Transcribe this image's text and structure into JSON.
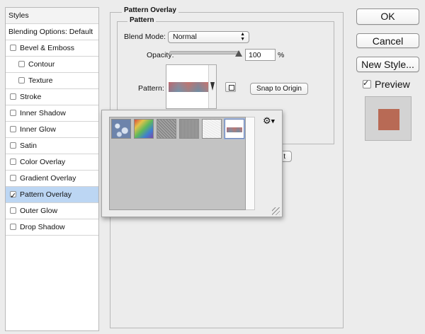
{
  "styles_panel": {
    "header": "Styles",
    "blending": "Blending Options: Default",
    "items": [
      {
        "label": "Bevel & Emboss",
        "checked": false,
        "indent": false
      },
      {
        "label": "Contour",
        "checked": false,
        "indent": true
      },
      {
        "label": "Texture",
        "checked": false,
        "indent": true
      },
      {
        "label": "Stroke",
        "checked": false,
        "indent": false
      },
      {
        "label": "Inner Shadow",
        "checked": false,
        "indent": false
      },
      {
        "label": "Inner Glow",
        "checked": false,
        "indent": false
      },
      {
        "label": "Satin",
        "checked": false,
        "indent": false
      },
      {
        "label": "Color Overlay",
        "checked": false,
        "indent": false
      },
      {
        "label": "Gradient Overlay",
        "checked": false,
        "indent": false
      },
      {
        "label": "Pattern Overlay",
        "checked": true,
        "indent": false
      },
      {
        "label": "Outer Glow",
        "checked": false,
        "indent": false
      },
      {
        "label": "Drop Shadow",
        "checked": false,
        "indent": false
      }
    ]
  },
  "pattern_overlay": {
    "section_title": "Pattern Overlay",
    "group_title": "Pattern",
    "blend_mode_label": "Blend Mode:",
    "blend_mode_value": "Normal",
    "opacity_label": "Opacity:",
    "opacity_value": "100",
    "opacity_unit": "%",
    "opacity_level": 1.0,
    "pattern_label": "Pattern:",
    "snap_button": "Snap to Origin",
    "hidden_button_fragment": "t"
  },
  "buttons": {
    "ok": "OK",
    "cancel": "Cancel",
    "new_style": "New Style...",
    "preview_label": "Preview",
    "preview_checked": true,
    "preview_color": "#b86a55"
  },
  "pattern_picker": {
    "thumbnails": [
      "bubbles-pattern",
      "rainbow-pattern",
      "gray-noise-pattern",
      "gray-fabric-pattern",
      "white-paper-pattern",
      "current-pattern"
    ],
    "selected_index": 5,
    "gear_icon": "gear-icon"
  },
  "colors": {
    "selection": "#bcd6f3",
    "background": "#ececec"
  }
}
